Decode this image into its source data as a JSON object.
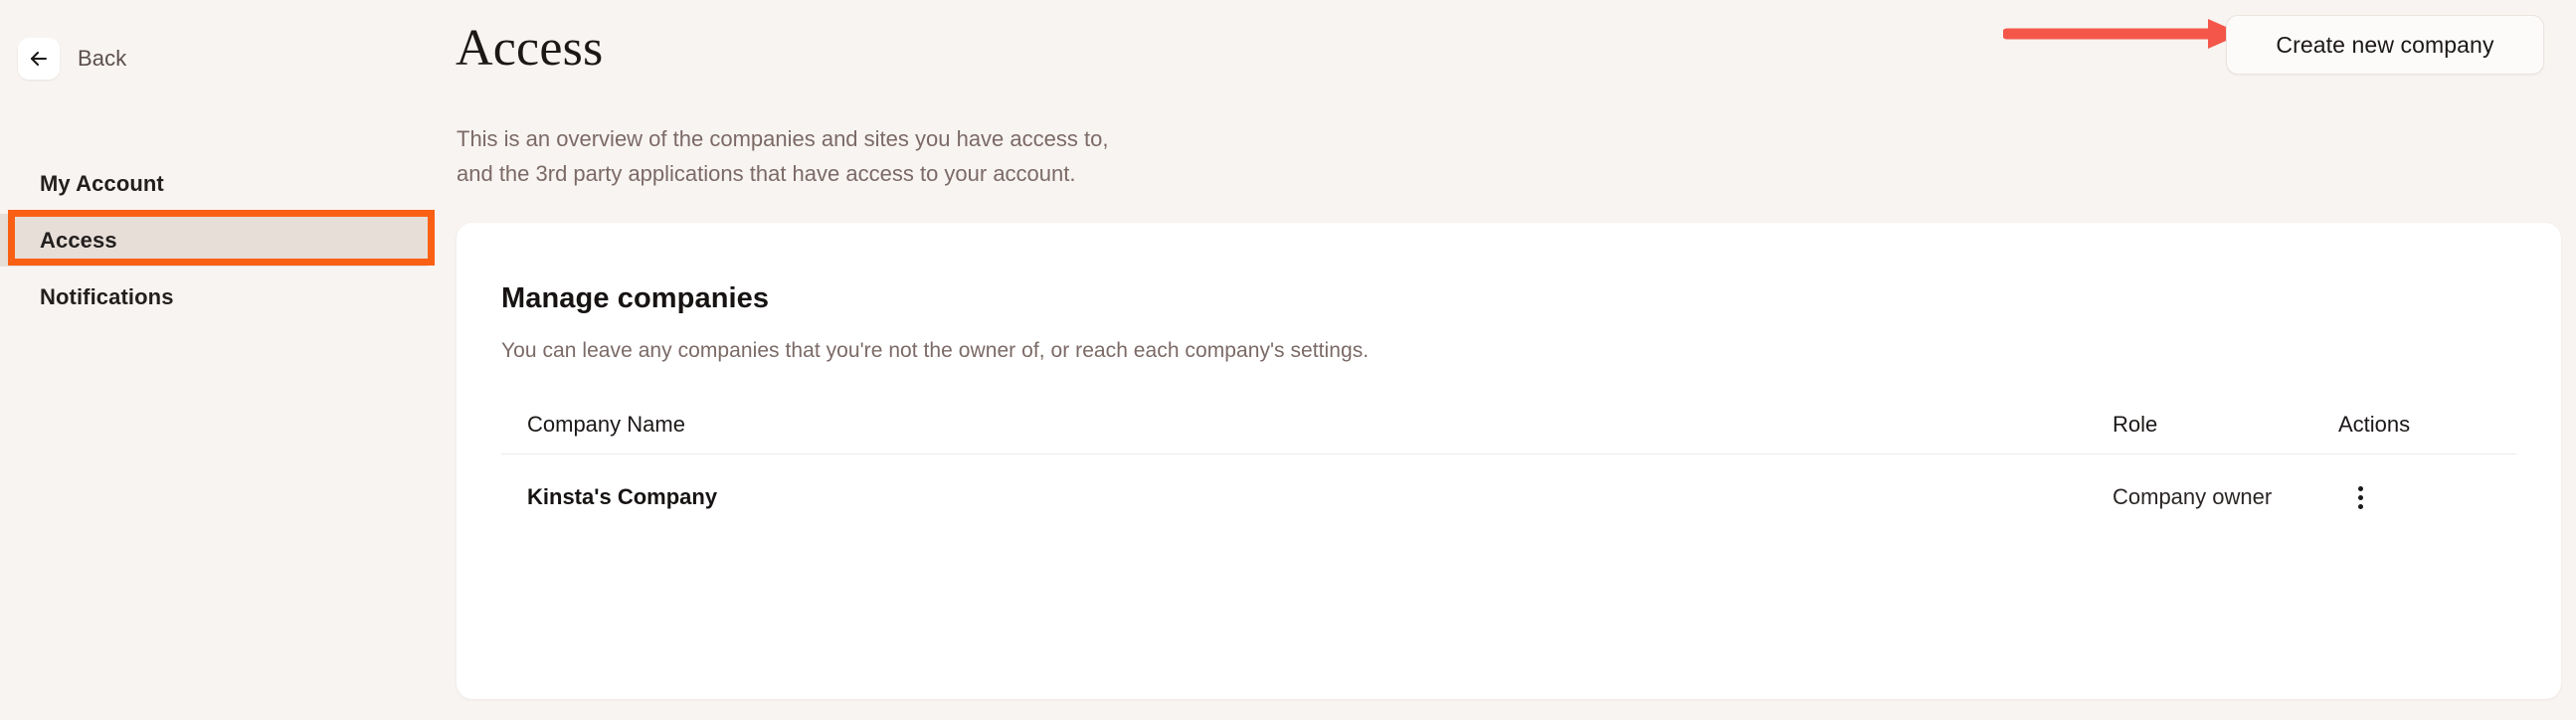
{
  "sidebar": {
    "back": {
      "label": "Back",
      "icon": "arrow-left-icon"
    },
    "items": [
      {
        "label": "My Account",
        "active": false
      },
      {
        "label": "Access",
        "active": true
      },
      {
        "label": "Notifications",
        "active": false
      }
    ]
  },
  "header": {
    "title": "Access",
    "subtitle": "This is an overview of the companies and sites you have access to,\nand the 3rd party applications that have access to your account.",
    "create_button_label": "Create new company"
  },
  "card": {
    "title": "Manage companies",
    "description": "You can leave any companies that you're not the owner of, or reach each company's settings.",
    "table": {
      "columns": [
        "Company Name",
        "Role",
        "Actions"
      ],
      "rows": [
        {
          "company_name": "Kinsta's Company",
          "role": "Company owner",
          "actions_icon": "kebab-menu-icon"
        }
      ]
    }
  },
  "annotations": {
    "arrow_color": "#f4574a",
    "highlight_color": "#f96014"
  },
  "colors": {
    "background": "#f8f4f1",
    "card": "#ffffff",
    "active_nav": "#e7ded8",
    "muted_text": "#7b6a66"
  }
}
